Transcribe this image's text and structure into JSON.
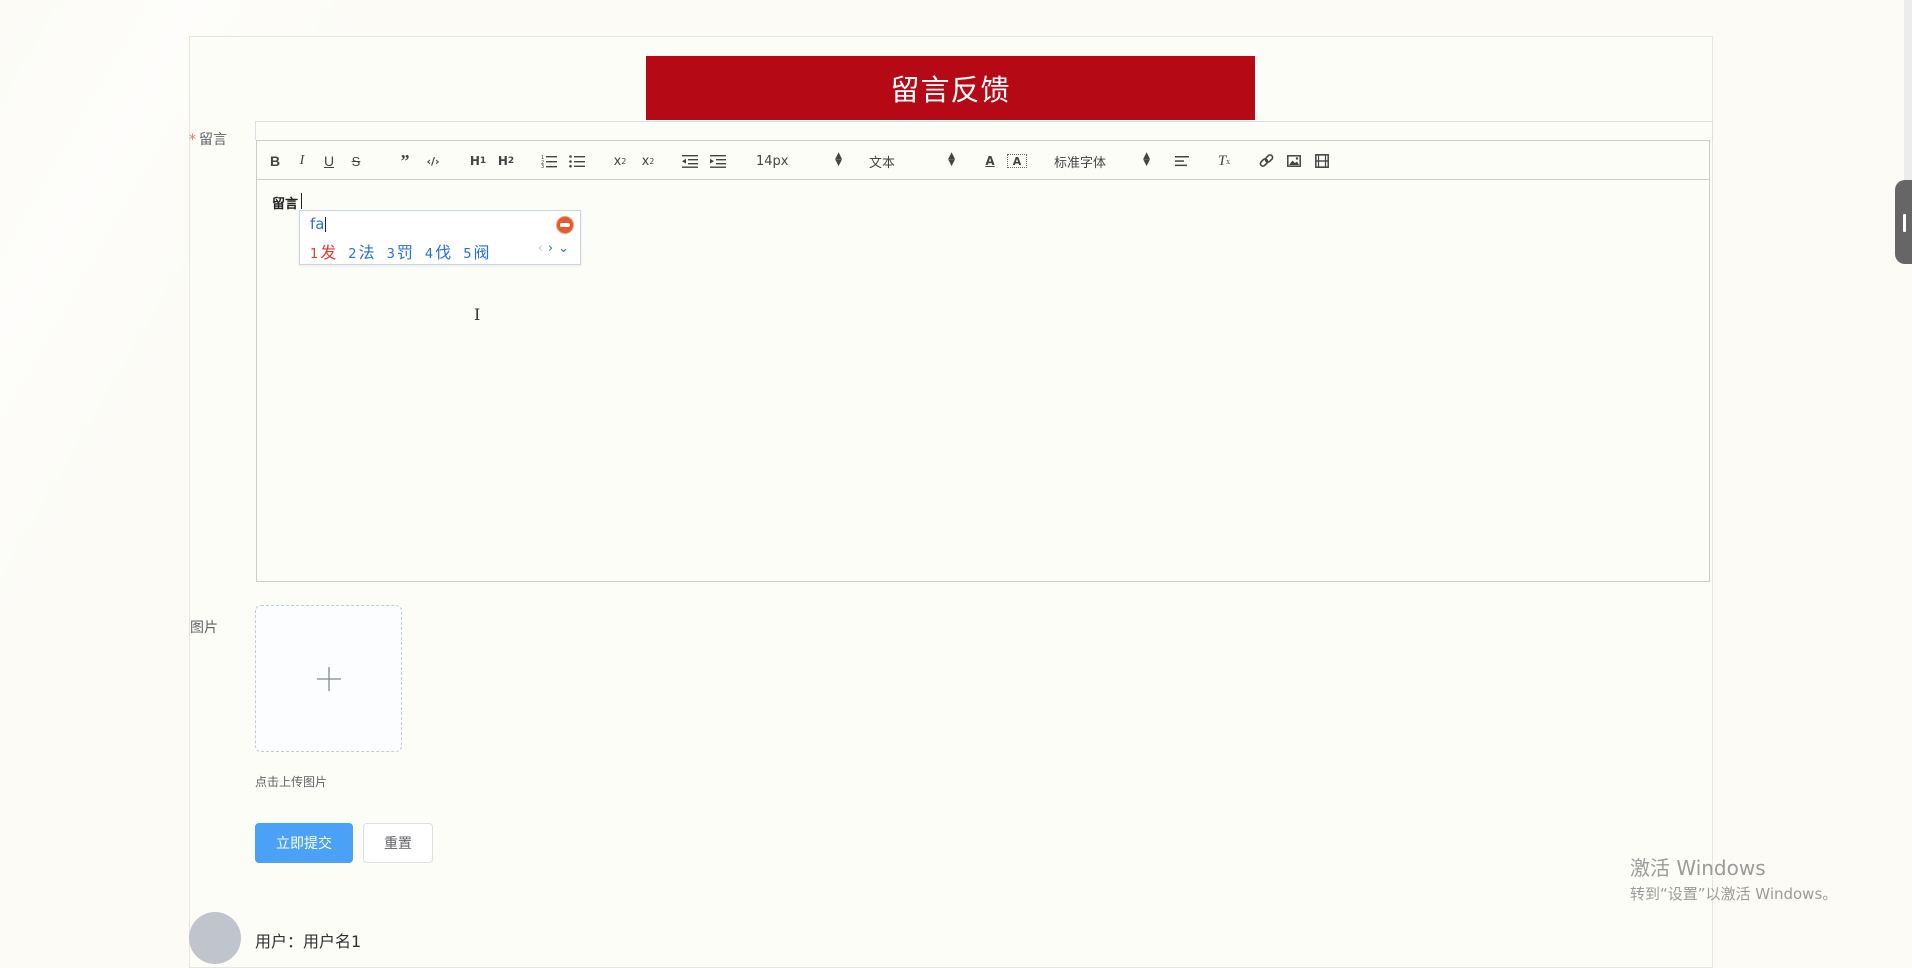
{
  "page": {
    "title": "留言反馈"
  },
  "form": {
    "message_label": "留言",
    "required_mark": "*",
    "image_label": "图片",
    "upload_tip": "点击上传图片",
    "submit_label": "立即提交",
    "reset_label": "重置"
  },
  "editor": {
    "content": "留言",
    "toolbar": {
      "font_size": "14px",
      "header_select": "文本",
      "font_family": "标准字体",
      "icons": [
        "bold-icon",
        "italic-icon",
        "underline-icon",
        "strikethrough-icon",
        "blockquote-icon",
        "code-block-icon",
        "h1-icon",
        "h2-icon",
        "ordered-list-icon",
        "bullet-list-icon",
        "subscript-icon",
        "superscript-icon",
        "outdent-icon",
        "indent-icon",
        "font-color-icon",
        "background-color-icon",
        "align-icon",
        "clean-format-icon",
        "link-icon",
        "image-icon",
        "video-icon"
      ]
    }
  },
  "ime": {
    "input": "fa",
    "candidates": [
      {
        "num": "1",
        "text": "发"
      },
      {
        "num": "2",
        "text": "法"
      },
      {
        "num": "3",
        "text": "罚"
      },
      {
        "num": "4",
        "text": "伐"
      },
      {
        "num": "5",
        "text": "阀"
      }
    ]
  },
  "comment": {
    "user_label": "用户：",
    "user_name": "用户名1"
  },
  "watermark": {
    "line1": "激活 Windows",
    "line2": "转到“设置”以激活 Windows。"
  },
  "colors": {
    "title_bg": "#b50a16",
    "primary": "#4ba1f5",
    "ime_blue": "#2a6fd6",
    "ime_red": "#e03a2f"
  }
}
